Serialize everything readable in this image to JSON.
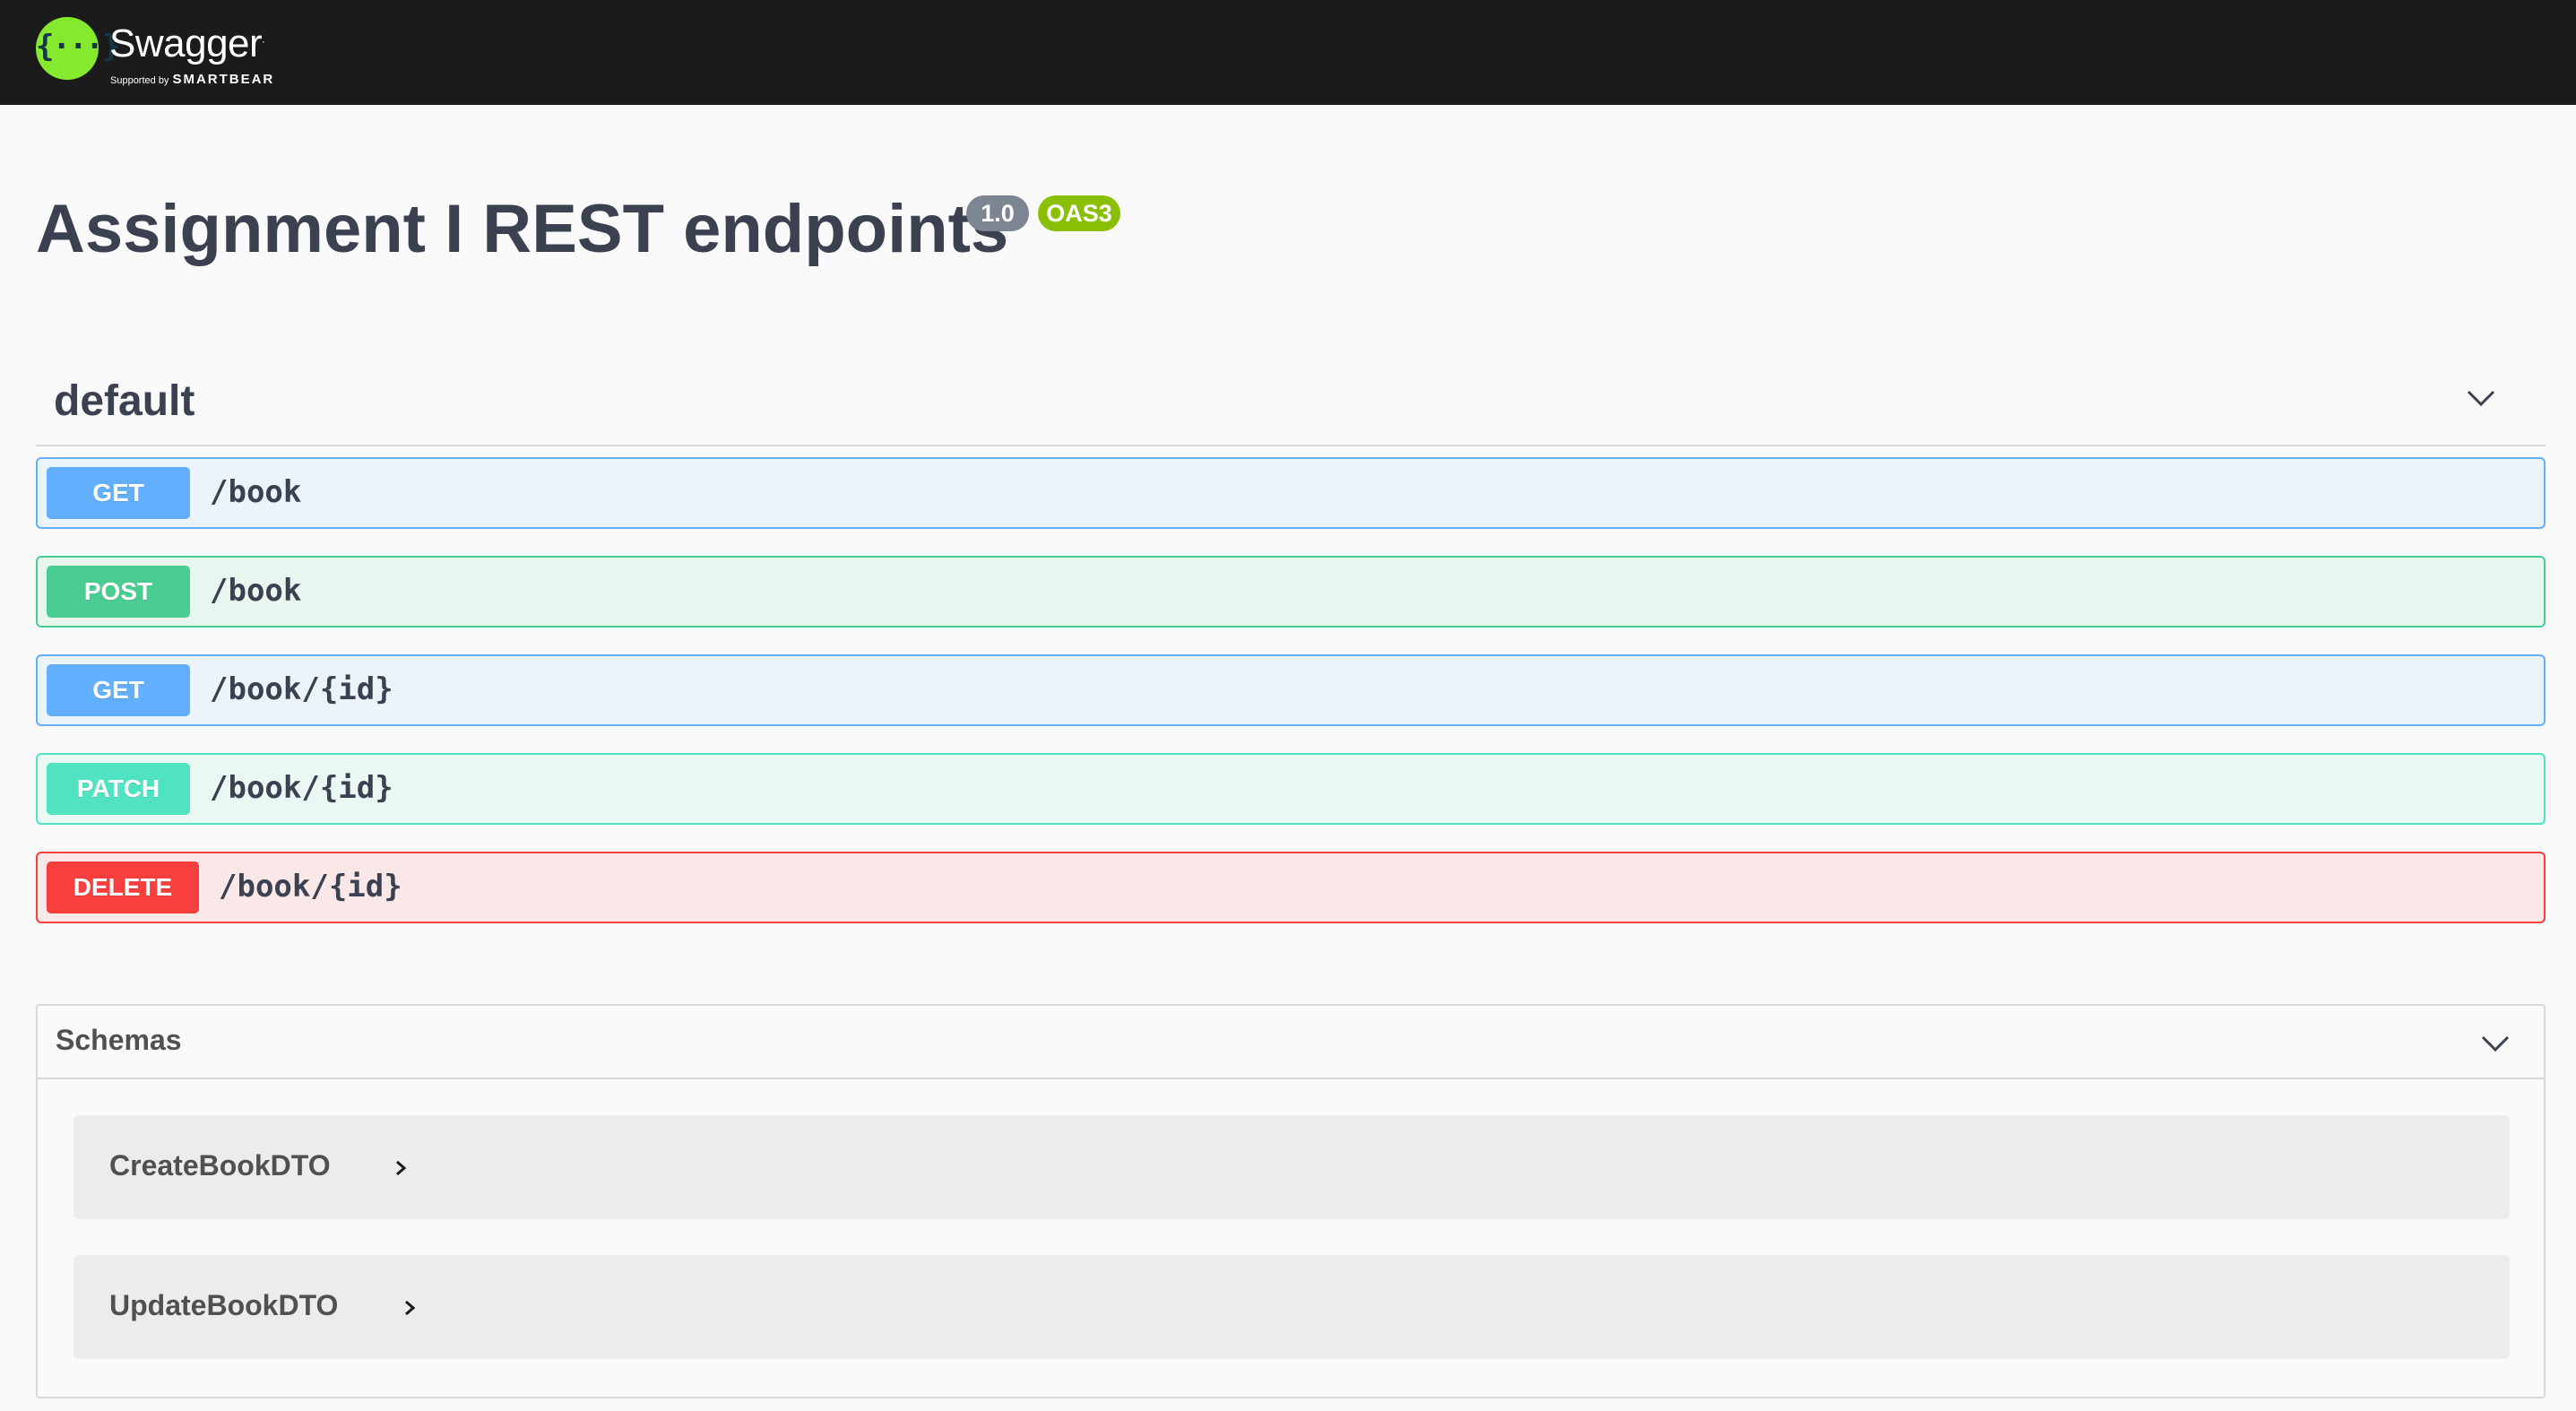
{
  "topbar": {
    "logo_word": "Swagger",
    "logo_tm": ".",
    "supported_by": "Supported by",
    "smartbear": "SMARTBEAR",
    "logo_icon": "swagger-braces-icon"
  },
  "info": {
    "title": "Assignment I REST endpoints",
    "version": "1.0",
    "oas": "OAS3"
  },
  "tag": {
    "name": "default",
    "toggle_icon": "chevron-down-icon"
  },
  "operations": [
    {
      "method": "GET",
      "path": "/book"
    },
    {
      "method": "POST",
      "path": "/book"
    },
    {
      "method": "GET",
      "path": "/book/{id}"
    },
    {
      "method": "PATCH",
      "path": "/book/{id}"
    },
    {
      "method": "DELETE",
      "path": "/book/{id}"
    }
  ],
  "schemas": {
    "title": "Schemas",
    "toggle_icon": "chevron-down-icon",
    "models": [
      {
        "name": "CreateBookDTO",
        "expand_icon": "chevron-right-icon"
      },
      {
        "name": "UpdateBookDTO",
        "expand_icon": "chevron-right-icon"
      }
    ]
  },
  "colors": {
    "topbar": "#1b1b1b",
    "logo_green": "#85ea2d",
    "get": "#61affe",
    "post": "#49cc90",
    "patch": "#50e3c2",
    "delete": "#f93e3e",
    "version_badge": "#7d8492",
    "oas_badge": "#89bf04"
  }
}
